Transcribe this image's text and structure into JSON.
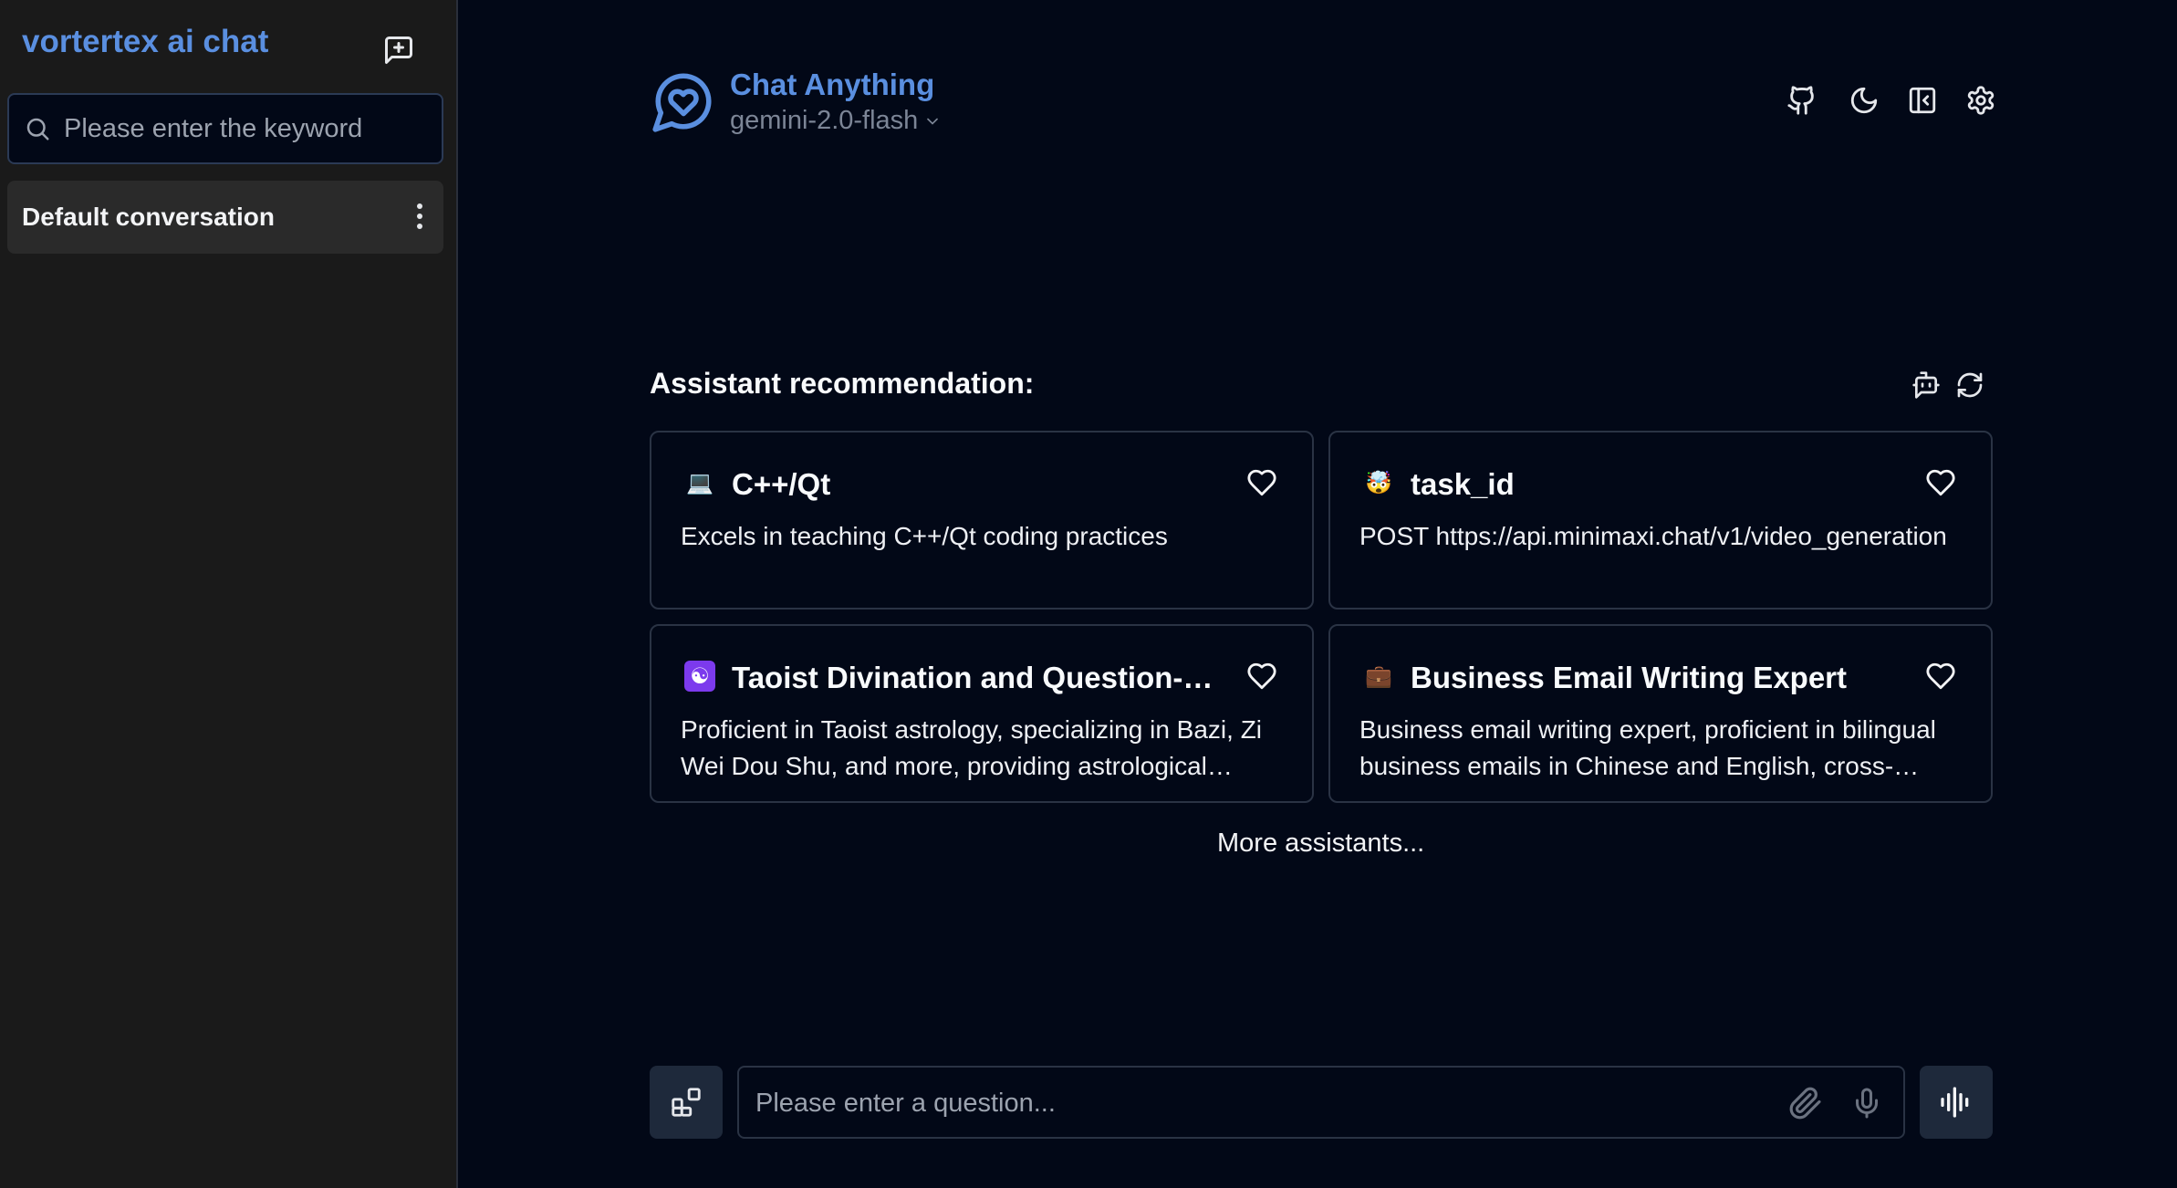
{
  "sidebar": {
    "app_title": "vortertex ai chat",
    "new_chat_icon": "message-plus-icon",
    "search": {
      "placeholder": "Please enter the keyword",
      "icon": "search-icon"
    },
    "conversations": [
      {
        "label": "Default conversation",
        "menu_icon": "more-vertical-icon"
      }
    ]
  },
  "header": {
    "logo_icon": "chat-heart-icon",
    "title": "Chat Anything",
    "model": "gemini-2.0-flash",
    "icons": [
      "github-icon",
      "moon-icon",
      "sidebar-collapse-icon",
      "settings-icon"
    ]
  },
  "recommendation": {
    "title": "Assistant recommendation:",
    "tool_icons": [
      "bot-icon",
      "refresh-icon"
    ],
    "cards": [
      {
        "emoji": "💻",
        "emoji_bg": "",
        "name": "C++/Qt",
        "desc": "Excels in teaching C++/Qt coding practices"
      },
      {
        "emoji": "🤯",
        "emoji_bg": "",
        "name": "task_id",
        "desc": "POST https://api.minimaxi.chat/v1/video_generation"
      },
      {
        "emoji": "☯",
        "emoji_bg": "#7c3aed",
        "name": "Taoist Divination and Question-Resolution Master",
        "desc": "Proficient in Taoist astrology, specializing in Bazi, Zi Wei Dou Shu, and more, providing astrological readings and guidance"
      },
      {
        "emoji": "💼",
        "emoji_bg": "",
        "name": "Business Email Writing Expert",
        "desc": "Business email writing expert, proficient in bilingual business emails in Chinese and English, cross-cultural communication and professional etiquette"
      }
    ],
    "more_label": "More assistants..."
  },
  "input": {
    "placeholder": "Please enter a question...",
    "tools_icon": "layout-blocks-icon",
    "attach_icon": "paperclip-icon",
    "mic_icon": "microphone-icon",
    "voice_icon": "audio-waveform-icon"
  },
  "colors": {
    "background": "#020817",
    "sidebar": "#1a1a1a",
    "accent": "#5a8fe0"
  }
}
